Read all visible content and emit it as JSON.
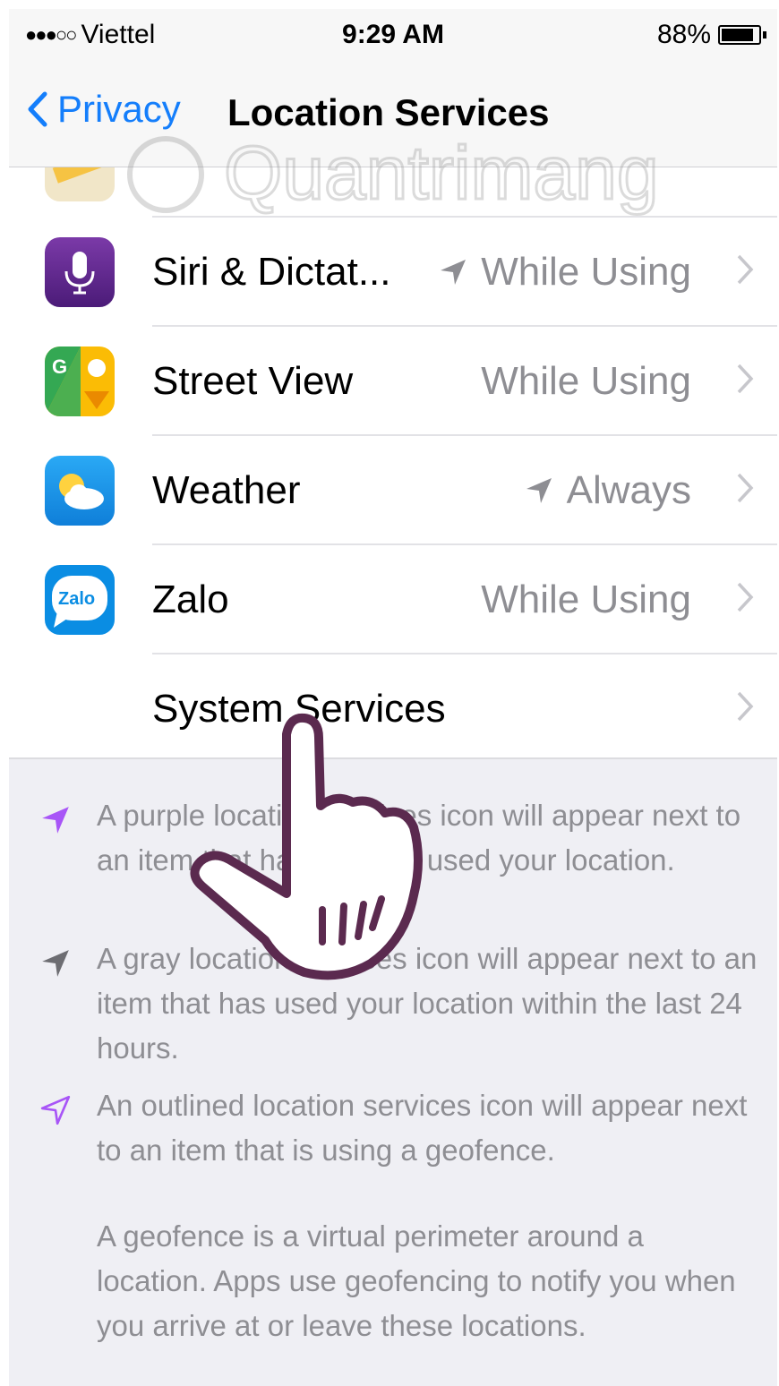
{
  "status_bar": {
    "carrier": "Viettel",
    "time": "9:29 AM",
    "battery": "88%",
    "battery_level": 0.88
  },
  "nav": {
    "back_label": "Privacy",
    "title": "Location Services"
  },
  "rows": [
    {
      "label": "Siri & Dictat...",
      "value": "While Using",
      "arrow": "gray"
    },
    {
      "label": "Street View",
      "value": "While Using"
    },
    {
      "label": "Weather",
      "value": "Always",
      "arrow": "gray"
    },
    {
      "label": "Zalo",
      "value": "While Using"
    },
    {
      "label": "System Services",
      "value": ""
    }
  ],
  "icons": {
    "siri": {
      "name": "microphone-icon",
      "color": "#6a2c91"
    },
    "street_view": {
      "name": "street-view-icon",
      "color": "#34a853"
    },
    "weather": {
      "name": "weather-icon",
      "color": "#1a9ff0"
    },
    "zalo": {
      "name": "zalo-icon",
      "text": "Zalo",
      "color": "#0a8de3"
    }
  },
  "footer": {
    "notes": [
      {
        "icon": "purple-location-arrow",
        "color": "#a855f7",
        "text": "A purple location services icon will appear next to an item that has recently used your location."
      },
      {
        "icon": "gray-location-arrow",
        "color": "#8e8e93",
        "text": "A gray location services icon will appear next to an item that has used your location within the last 24 hours."
      },
      {
        "icon": "outlined-location-arrow",
        "color": "#a855f7",
        "text": "An outlined location services icon will appear next to an item that is using a geofence."
      },
      {
        "icon": "",
        "text": "A geofence is a virtual perimeter around a location. Apps use geofencing to notify you when you arrive at or leave these locations."
      }
    ]
  },
  "watermark": "Quantrimang"
}
